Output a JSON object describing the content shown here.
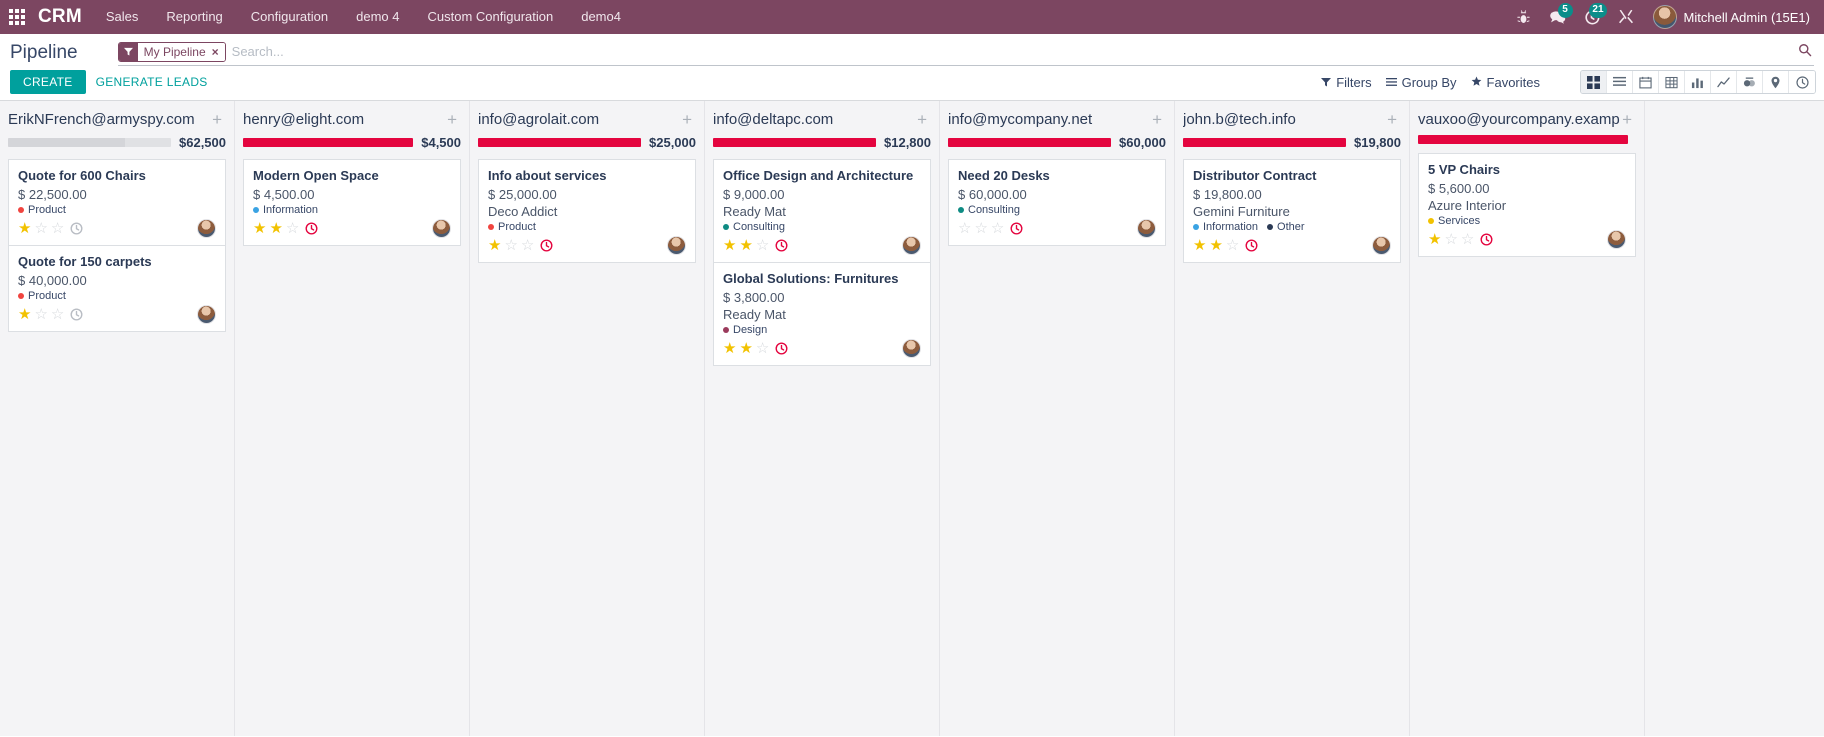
{
  "navbar": {
    "apps_icon": "apps-grid-icon",
    "brand": "CRM",
    "menu": [
      {
        "label": "Sales"
      },
      {
        "label": "Reporting"
      },
      {
        "label": "Configuration"
      },
      {
        "label": "demo 4"
      },
      {
        "label": "Custom Configuration"
      },
      {
        "label": "demo4"
      }
    ],
    "systray": [
      {
        "name": "bug-icon",
        "badge": ""
      },
      {
        "name": "messages-icon",
        "badge": "5"
      },
      {
        "name": "activities-clock-icon",
        "badge": "21"
      },
      {
        "name": "debug-tools-icon",
        "badge": ""
      }
    ],
    "user": {
      "name": "Mitchell Admin (15E1)",
      "avatar": "user-avatar"
    }
  },
  "control_panel": {
    "title": "Pipeline",
    "search": {
      "facet_label": "My Pipeline",
      "facet_icon": "filter-icon",
      "facet_remove": "×",
      "placeholder": "Search...",
      "magnifier_icon": "search-icon"
    },
    "buttons": {
      "create": "CREATE",
      "generate_leads": "GENERATE LEADS"
    },
    "dropdowns": [
      {
        "label": "Filters",
        "icon": "filter-icon"
      },
      {
        "label": "Group By",
        "icon": "list-icon"
      },
      {
        "label": "Favorites",
        "icon": "star-icon"
      }
    ],
    "views": [
      {
        "name": "kanban-view-icon",
        "active": true
      },
      {
        "name": "list-view-icon",
        "active": false
      },
      {
        "name": "calendar-view-icon",
        "active": false
      },
      {
        "name": "pivot-view-icon",
        "active": false
      },
      {
        "name": "bar-chart-view-icon",
        "active": false
      },
      {
        "name": "line-chart-view-icon",
        "active": false
      },
      {
        "name": "cohort-view-icon",
        "active": false
      },
      {
        "name": "map-view-icon",
        "active": false
      },
      {
        "name": "activity-view-icon",
        "active": false
      }
    ]
  },
  "colors": {
    "brand_purple": "#7c4661",
    "teal": "#00a09d",
    "progress_red": "#e4053f",
    "progress_grey": "#d4d5d9"
  },
  "kanban": {
    "add_column_label": "+",
    "columns": [
      {
        "title": "ErikNFrench@armyspy.com",
        "amount": "$62,500",
        "bar_color": "#d4d5d9",
        "bar_pct": 72,
        "cards": [
          {
            "title": "Quote for 600 Chairs",
            "amount": "$ 22,500.00",
            "partner": "",
            "tags": [
              {
                "label": "Product",
                "color": "#f0443f"
              }
            ],
            "stars": 1,
            "clock": "grey",
            "avatar": "assignee-avatar"
          },
          {
            "title": "Quote for 150 carpets",
            "amount": "$ 40,000.00",
            "partner": "",
            "tags": [
              {
                "label": "Product",
                "color": "#f0443f"
              }
            ],
            "stars": 1,
            "clock": "grey",
            "avatar": "assignee-avatar"
          }
        ]
      },
      {
        "title": "henry@elight.com",
        "amount": "$4,500",
        "bar_color": "#e4053f",
        "bar_pct": 100,
        "cards": [
          {
            "title": "Modern Open Space",
            "amount": "$ 4,500.00",
            "partner": "",
            "tags": [
              {
                "label": "Information",
                "color": "#3aa3e3"
              }
            ],
            "stars": 2,
            "clock": "red",
            "avatar": "assignee-avatar"
          }
        ]
      },
      {
        "title": "info@agrolait.com",
        "amount": "$25,000",
        "bar_color": "#e4053f",
        "bar_pct": 100,
        "cards": [
          {
            "title": "Info about services",
            "amount": "$ 25,000.00",
            "partner": "Deco Addict",
            "tags": [
              {
                "label": "Product",
                "color": "#f0443f"
              }
            ],
            "stars": 1,
            "clock": "red",
            "avatar": "assignee-avatar"
          }
        ]
      },
      {
        "title": "info@deltapc.com",
        "amount": "$12,800",
        "bar_color": "#e4053f",
        "bar_pct": 100,
        "cards": [
          {
            "title": "Office Design and Architecture",
            "amount": "$ 9,000.00",
            "partner": "Ready Mat",
            "tags": [
              {
                "label": "Consulting",
                "color": "#0e8b83"
              }
            ],
            "stars": 2,
            "clock": "red",
            "avatar": "assignee-avatar"
          },
          {
            "title": "Global Solutions: Furnitures",
            "amount": "$ 3,800.00",
            "partner": "Ready Mat",
            "tags": [
              {
                "label": "Design",
                "color": "#9b3a5c"
              }
            ],
            "stars": 2,
            "clock": "red",
            "avatar": "assignee-avatar"
          }
        ]
      },
      {
        "title": "info@mycompany.net",
        "amount": "$60,000",
        "bar_color": "#e4053f",
        "bar_pct": 100,
        "cards": [
          {
            "title": "Need 20 Desks",
            "amount": "$ 60,000.00",
            "partner": "",
            "tags": [
              {
                "label": "Consulting",
                "color": "#0e8b83"
              }
            ],
            "stars": 0,
            "clock": "red",
            "avatar": "assignee-avatar"
          }
        ]
      },
      {
        "title": "john.b@tech.info",
        "amount": "$19,800",
        "bar_color": "#e4053f",
        "bar_pct": 100,
        "cards": [
          {
            "title": "Distributor Contract",
            "amount": "$ 19,800.00",
            "partner": "Gemini Furniture",
            "tags": [
              {
                "label": "Information",
                "color": "#3aa3e3"
              },
              {
                "label": "Other",
                "color": "#2b3a55"
              }
            ],
            "stars": 2,
            "clock": "red",
            "avatar": "assignee-avatar"
          }
        ]
      },
      {
        "title": "vauxoo@yourcompany.example.com",
        "amount": "",
        "bar_color": "#e4053f",
        "bar_pct": 100,
        "cards": [
          {
            "title": "5 VP Chairs",
            "amount": "$ 5,600.00",
            "partner": "Azure Interior",
            "tags": [
              {
                "label": "Services",
                "color": "#f2c200"
              }
            ],
            "stars": 1,
            "clock": "red",
            "avatar": "assignee-avatar"
          }
        ]
      }
    ]
  }
}
